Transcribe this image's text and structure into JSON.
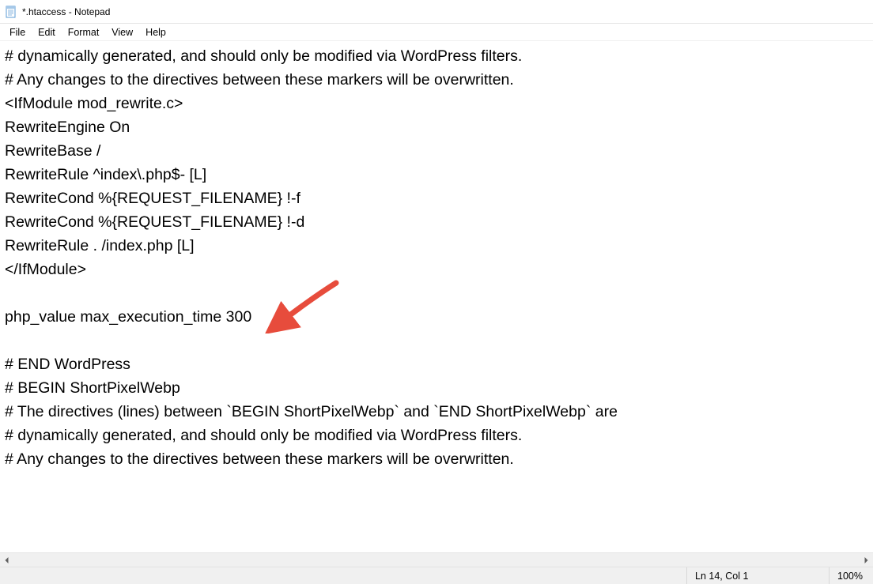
{
  "titlebar": {
    "title": "*.htaccess - Notepad"
  },
  "menubar": {
    "items": [
      "File",
      "Edit",
      "Format",
      "View",
      "Help"
    ]
  },
  "editor": {
    "content": "# dynamically generated, and should only be modified via WordPress filters.\n# Any changes to the directives between these markers will be overwritten.\n<IfModule mod_rewrite.c>\nRewriteEngine On\nRewriteBase /\nRewriteRule ^index\\.php$- [L]\nRewriteCond %{REQUEST_FILENAME} !-f\nRewriteCond %{REQUEST_FILENAME} !-d\nRewriteRule . /index.php [L]\n</IfModule>\n\nphp_value max_execution_time 300\n\n# END WordPress\n# BEGIN ShortPixelWebp\n# The directives (lines) between `BEGIN ShortPixelWebp` and `END ShortPixelWebp` are\n# dynamically generated, and should only be modified via WordPress filters.\n# Any changes to the directives between these markers will be overwritten.\n"
  },
  "statusbar": {
    "position": "Ln 14, Col 1",
    "zoom": "100%"
  }
}
